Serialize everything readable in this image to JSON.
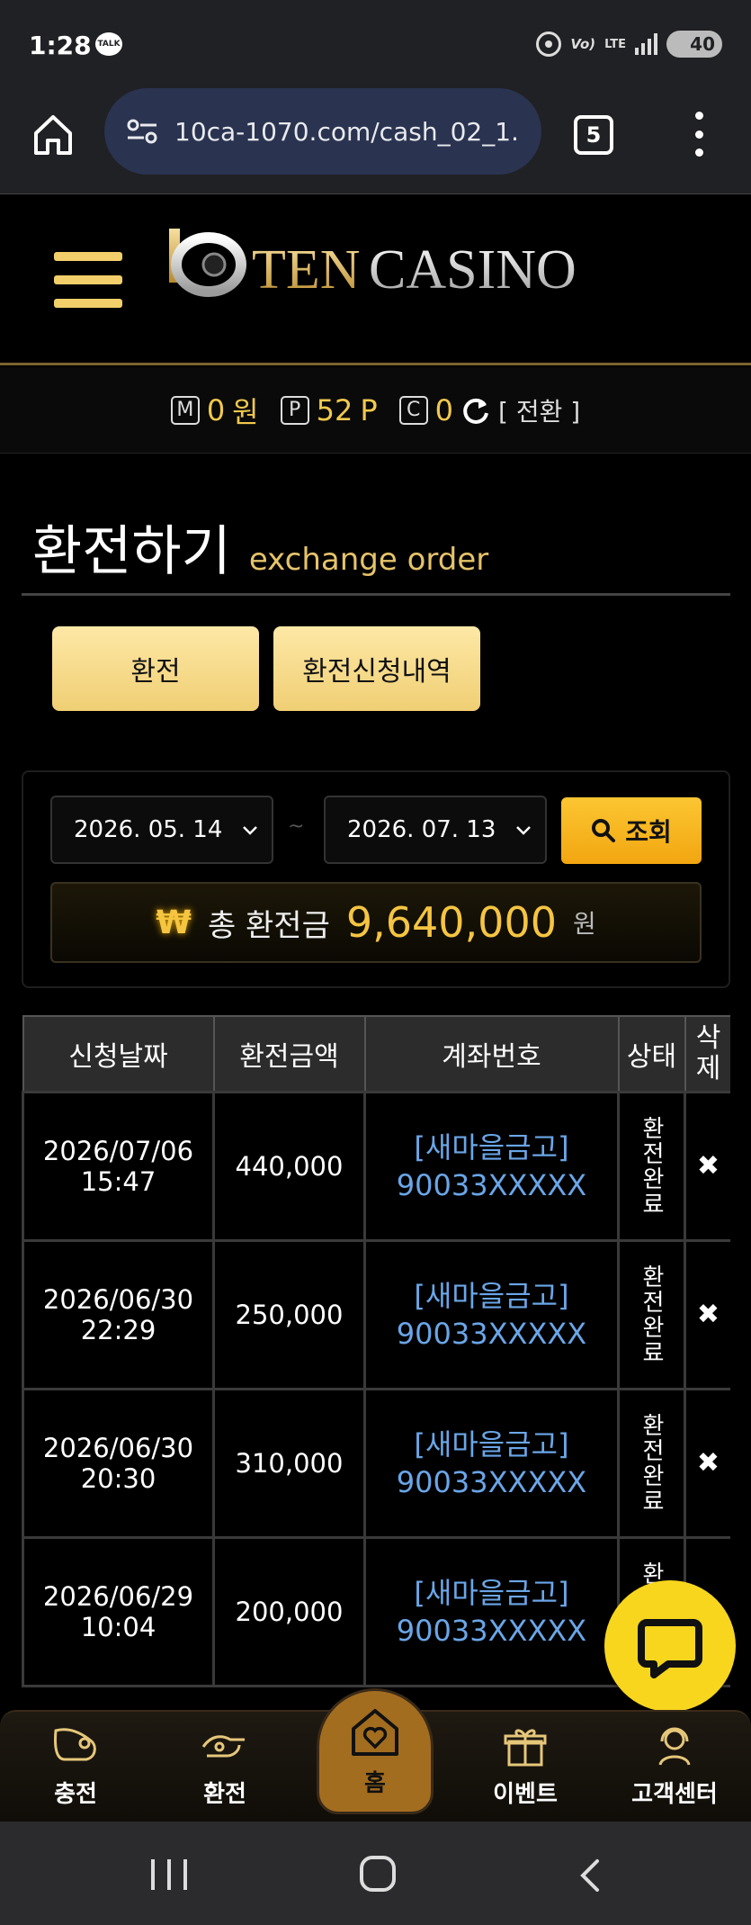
{
  "status_bar": {
    "time": "1:28",
    "talk_badge": "TALK",
    "volte": "Vo)",
    "lte": "LTE",
    "battery": "40"
  },
  "browser": {
    "url": "10ca-1070.com/cash_02_1.",
    "tab_count": "5"
  },
  "site": {
    "logo_text": "TEN CASINO"
  },
  "wallet": {
    "money_badge": "M",
    "money_value": "0",
    "money_unit": "원",
    "point_badge": "P",
    "point_value": "52",
    "point_unit": "P",
    "comp_badge": "C",
    "comp_value": "0",
    "convert_label": "[ 전환 ]"
  },
  "page": {
    "title": "환전하기",
    "subtitle": "exchange order"
  },
  "tabs": {
    "exchange_label": "환전",
    "history_label": "환전신청내역"
  },
  "search": {
    "date_from": "2026. 05. 14",
    "date_to": "2026. 07. 13",
    "separator": "~",
    "button_label": "조회"
  },
  "total": {
    "currency_symbol": "₩",
    "label": "총 환전금",
    "value": "9,640,000",
    "unit": "원"
  },
  "table": {
    "headers": {
      "date": "신청날짜",
      "amount": "환전금액",
      "account": "계좌번호",
      "status": "상태",
      "delete": "삭제"
    },
    "rows": [
      {
        "date": "2026/07/06",
        "time": "15:47",
        "amount": "440,000",
        "bank": "[새마을금고]",
        "account": "90033XXXXX",
        "status": "환전완료"
      },
      {
        "date": "2026/06/30",
        "time": "22:29",
        "amount": "250,000",
        "bank": "[새마을금고]",
        "account": "90033XXXXX",
        "status": "환전완료"
      },
      {
        "date": "2026/06/30",
        "time": "20:30",
        "amount": "310,000",
        "bank": "[새마을금고]",
        "account": "90033XXXXX",
        "status": "환전완료"
      },
      {
        "date": "2026/06/29",
        "time": "10:04",
        "amount": "200,000",
        "bank": "[새마을금고]",
        "account": "90033XXXXX",
        "status": "환전완료"
      }
    ],
    "delete_symbol": "✖"
  },
  "bottom_nav": {
    "charge": "충전",
    "exchange": "환전",
    "home": "홈",
    "event": "이벤트",
    "support": "고객센터"
  },
  "colors": {
    "accent_gold": "#f2c94c",
    "link_blue": "#6aa6e8",
    "chat_yellow": "#f7d61d"
  }
}
